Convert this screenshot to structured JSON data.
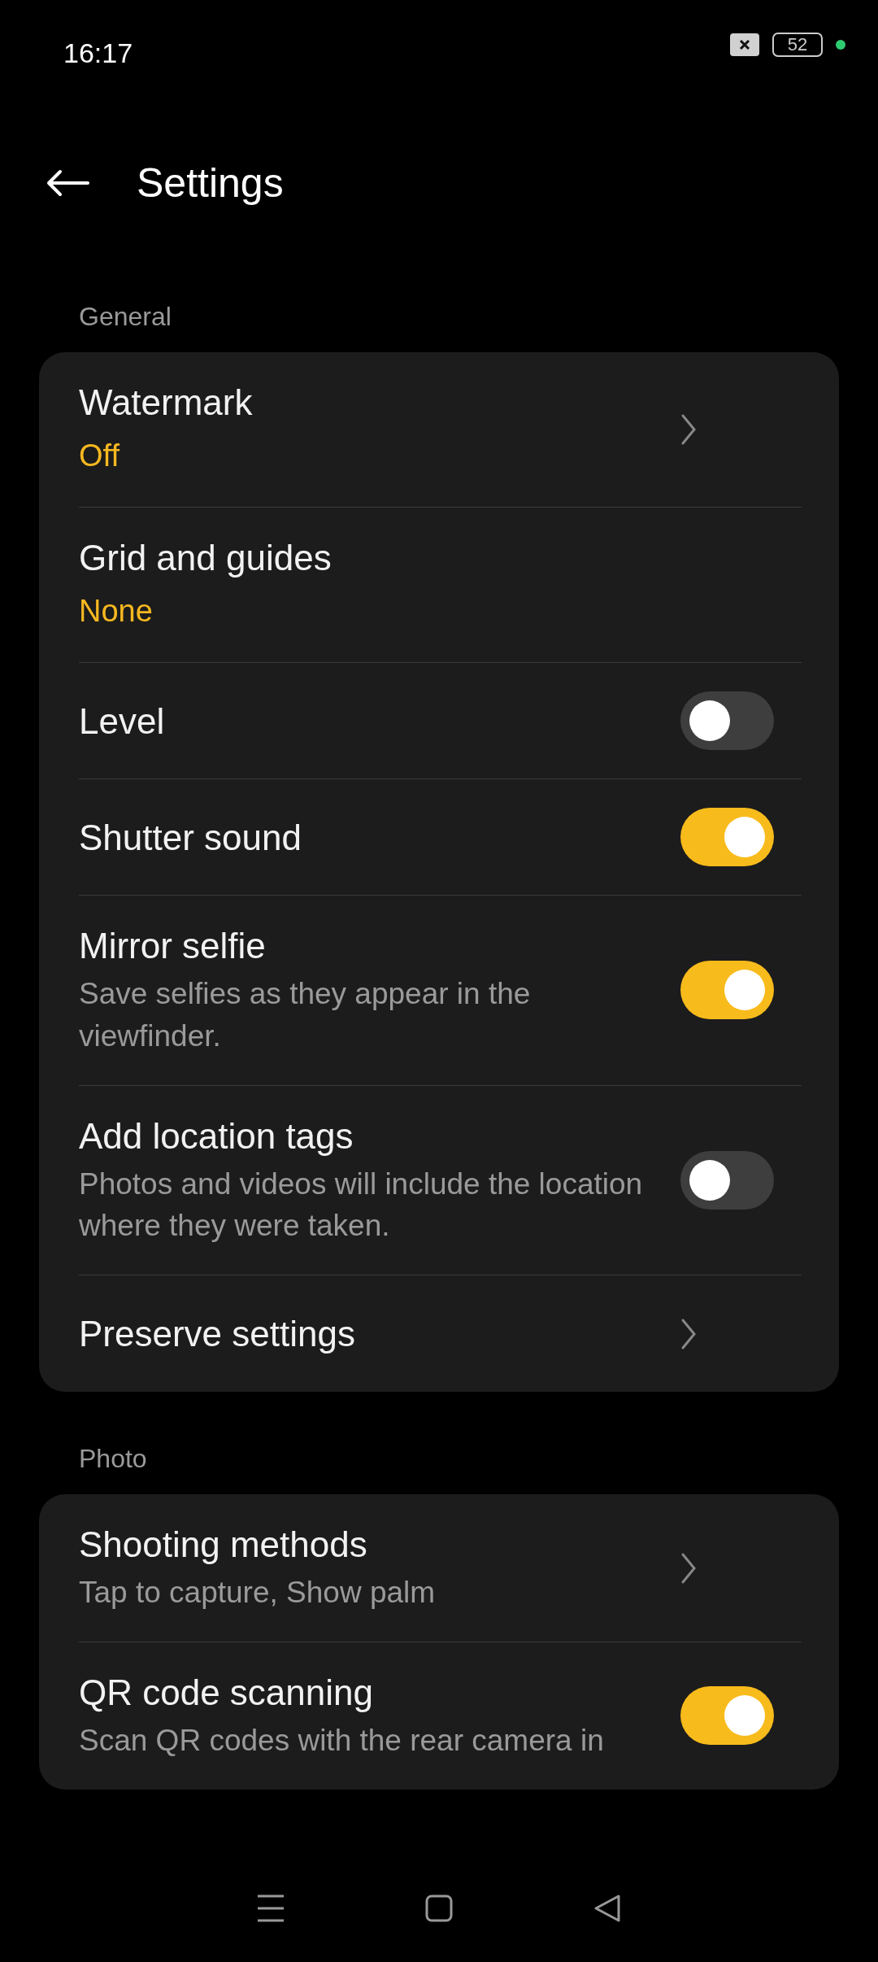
{
  "status_bar": {
    "time": "16:17",
    "battery": "52"
  },
  "header": {
    "title": "Settings"
  },
  "sections": [
    {
      "label": "General",
      "items": [
        {
          "kind": "link",
          "title": "Watermark",
          "value": "Off"
        },
        {
          "kind": "plain",
          "title": "Grid and guides",
          "value": "None"
        },
        {
          "kind": "toggle",
          "title": "Level",
          "on": false
        },
        {
          "kind": "toggle",
          "title": "Shutter sound",
          "on": true
        },
        {
          "kind": "toggle",
          "title": "Mirror selfie",
          "subtitle": "Save selfies as they appear in the viewfinder.",
          "on": true
        },
        {
          "kind": "toggle",
          "title": "Add location tags",
          "subtitle": "Photos and videos will include the location where they were taken.",
          "on": false
        },
        {
          "kind": "link",
          "title": "Preserve settings"
        }
      ]
    },
    {
      "label": "Photo",
      "items": [
        {
          "kind": "link",
          "title": "Shooting methods",
          "subtitle": "Tap to capture, Show palm"
        },
        {
          "kind": "toggle",
          "title": "QR code scanning",
          "subtitle": "Scan QR codes with the rear camera in",
          "on": true
        }
      ]
    }
  ]
}
